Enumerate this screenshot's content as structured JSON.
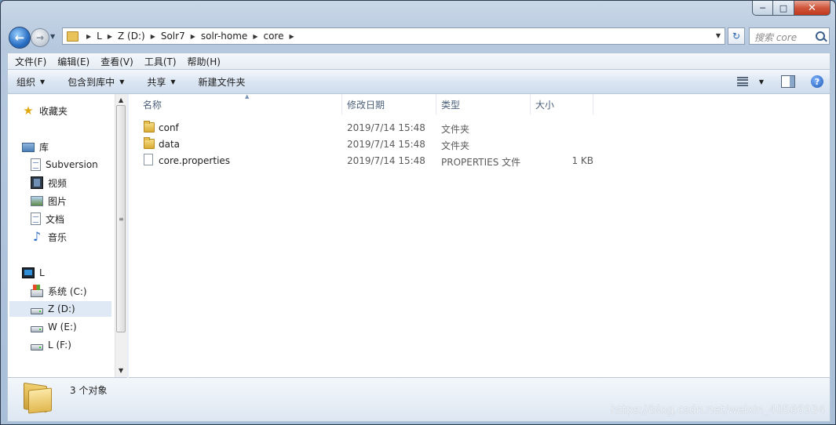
{
  "window": {
    "caption_buttons": {
      "minimize": "─",
      "maximize": "□",
      "close": "✕"
    }
  },
  "nav": {
    "back_icon": "back-arrow-icon",
    "forward_icon": "forward-arrow-icon",
    "breadcrumb": [
      "L",
      "Z (D:)",
      "Solr7",
      "solr-home",
      "core"
    ],
    "search_placeholder": "搜索 core"
  },
  "menu": [
    "文件(F)",
    "编辑(E)",
    "查看(V)",
    "工具(T)",
    "帮助(H)"
  ],
  "toolbar": {
    "organize": "组织",
    "include_library": "包含到库中",
    "share": "共享",
    "new_folder": "新建文件夹",
    "help": "?"
  },
  "sidebar": {
    "favorites": "收藏夹",
    "libraries": "库",
    "library_items": [
      "Subversion",
      "视频",
      "图片",
      "文档",
      "音乐"
    ],
    "computer": "L",
    "drives": [
      "系统 (C:)",
      "Z (D:)",
      "W (E:)",
      "L (F:)"
    ],
    "selected_drive": "Z (D:)"
  },
  "columns": [
    "名称",
    "修改日期",
    "类型",
    "大小"
  ],
  "files": [
    {
      "name": "conf",
      "date": "2019/7/14 15:48",
      "type": "文件夹",
      "size": "",
      "icon": "folder-icon"
    },
    {
      "name": "data",
      "date": "2019/7/14 15:48",
      "type": "文件夹",
      "size": "",
      "icon": "folder-icon"
    },
    {
      "name": "core.properties",
      "date": "2019/7/14 15:48",
      "type": "PROPERTIES 文件",
      "size": "1 KB",
      "icon": "file-icon"
    }
  ],
  "details": {
    "count": "3 个对象",
    "watermark": "https://blog.csdn.net/weixin_40566934"
  }
}
